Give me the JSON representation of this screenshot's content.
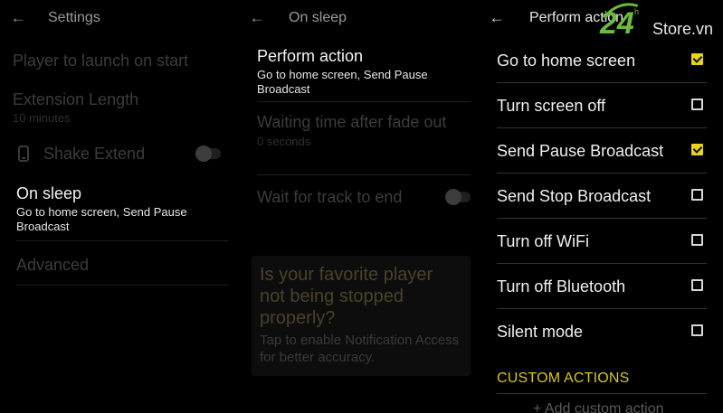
{
  "colors": {
    "accent": "#e8d318",
    "background": "#000000",
    "watermark_green": "#6dbb3c"
  },
  "settings_panel": {
    "back_icon": "arrow-left-icon",
    "title": "Settings",
    "items": [
      {
        "label": "Player to launch on start"
      },
      {
        "label": "Extension Length",
        "sub": "10 minutes"
      },
      {
        "label": "Shake Extend",
        "icon": "phone-icon",
        "toggle_on": false
      },
      {
        "label": "On sleep",
        "sub": "Go to home screen, Send Pause Broadcast"
      },
      {
        "label": "Advanced"
      }
    ]
  },
  "on_sleep_panel": {
    "back_icon": "arrow-left-icon",
    "title": "On sleep",
    "items": [
      {
        "label": "Perform action",
        "sub": "Go to home screen, Send Pause Broadcast"
      },
      {
        "label": "Waiting time after fade out",
        "sub": "0 seconds"
      },
      {
        "label": "Wait for track to end",
        "toggle_on": false
      }
    ],
    "hint": {
      "question": "Is your favorite player not being stopped properly?",
      "text": "Tap to enable Notification Access for better accuracy."
    }
  },
  "perform_action_panel": {
    "back_icon": "arrow-left-icon",
    "title": "Perform action",
    "options": [
      {
        "label": "Go to home screen",
        "checked": true
      },
      {
        "label": "Turn screen off",
        "checked": false
      },
      {
        "label": "Send Pause Broadcast",
        "checked": true
      },
      {
        "label": "Send Stop Broadcast",
        "checked": false
      },
      {
        "label": "Turn off WiFi",
        "checked": false
      },
      {
        "label": "Turn off Bluetooth",
        "checked": false
      },
      {
        "label": "Silent mode",
        "checked": false
      }
    ],
    "section_header": "CUSTOM ACTIONS",
    "add_custom_action": "+ Add custom action"
  },
  "watermark": {
    "number": "24",
    "superscript": "h",
    "text": "Store.vn"
  }
}
